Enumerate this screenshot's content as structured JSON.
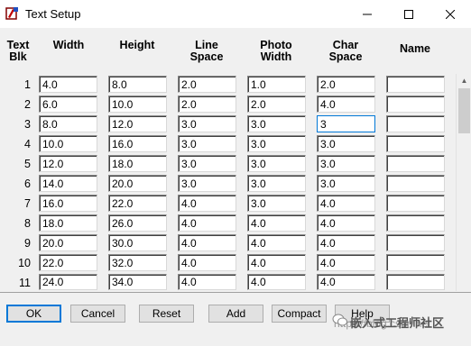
{
  "window": {
    "title": "Text Setup"
  },
  "columns": {
    "block": "Text\nBlk",
    "width": "Width",
    "height": "Height",
    "line_space": "Line\nSpace",
    "photo_width": "Photo\nWidth",
    "char_space": "Char\nSpace",
    "name": "Name"
  },
  "rows": [
    {
      "blk": "1",
      "width": "4.0",
      "height": "8.0",
      "line": "2.0",
      "photo": "1.0",
      "char": "2.0",
      "name": ""
    },
    {
      "blk": "2",
      "width": "6.0",
      "height": "10.0",
      "line": "2.0",
      "photo": "2.0",
      "char": "4.0",
      "name": ""
    },
    {
      "blk": "3",
      "width": "8.0",
      "height": "12.0",
      "line": "3.0",
      "photo": "3.0",
      "char": "3",
      "name": ""
    },
    {
      "blk": "4",
      "width": "10.0",
      "height": "16.0",
      "line": "3.0",
      "photo": "3.0",
      "char": "3.0",
      "name": ""
    },
    {
      "blk": "5",
      "width": "12.0",
      "height": "18.0",
      "line": "3.0",
      "photo": "3.0",
      "char": "3.0",
      "name": ""
    },
    {
      "blk": "6",
      "width": "14.0",
      "height": "20.0",
      "line": "3.0",
      "photo": "3.0",
      "char": "3.0",
      "name": ""
    },
    {
      "blk": "7",
      "width": "16.0",
      "height": "22.0",
      "line": "4.0",
      "photo": "3.0",
      "char": "4.0",
      "name": ""
    },
    {
      "blk": "8",
      "width": "18.0",
      "height": "26.0",
      "line": "4.0",
      "photo": "4.0",
      "char": "4.0",
      "name": ""
    },
    {
      "blk": "9",
      "width": "20.0",
      "height": "30.0",
      "line": "4.0",
      "photo": "4.0",
      "char": "4.0",
      "name": ""
    },
    {
      "blk": "10",
      "width": "22.0",
      "height": "32.0",
      "line": "4.0",
      "photo": "4.0",
      "char": "4.0",
      "name": ""
    },
    {
      "blk": "11",
      "width": "24.0",
      "height": "34.0",
      "line": "4.0",
      "photo": "4.0",
      "char": "4.0",
      "name": ""
    }
  ],
  "buttons": {
    "ok": "OK",
    "cancel": "Cancel",
    "reset": "Reset",
    "add": "Add",
    "compact": "Compact",
    "help": "Help"
  },
  "watermark": {
    "url": "https://blog.csdn.net",
    "brand": "嵌入式工程师社区"
  },
  "colors": {
    "focus": "#0078d7",
    "window_bg": "#f0f0f0"
  }
}
